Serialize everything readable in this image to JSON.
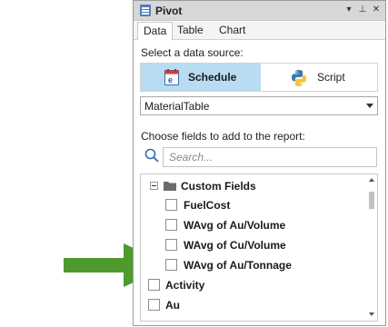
{
  "window": {
    "title": "Pivot",
    "dropdown_glyph": "▾",
    "pin_glyph": "⊥",
    "close_glyph": "✕"
  },
  "tabs": [
    {
      "label": "Data",
      "active": true
    },
    {
      "label": "Table",
      "active": false
    },
    {
      "label": "Chart",
      "active": false
    }
  ],
  "source": {
    "label": "Select a data source:",
    "options": [
      {
        "label": "Schedule",
        "icon": "schedule-icon",
        "selected": true
      },
      {
        "label": "Script",
        "icon": "python-icon",
        "selected": false
      }
    ],
    "selected_table": "MaterialTable"
  },
  "fields": {
    "label": "Choose fields to add to the report:",
    "search_placeholder": "Search...",
    "tree": [
      {
        "label": "Custom Fields",
        "type": "folder",
        "expanded": true
      },
      {
        "label": "FuelCost",
        "type": "field"
      },
      {
        "label": "WAvg of Au/Volume",
        "type": "field"
      },
      {
        "label": "WAvg of Cu/Volume",
        "type": "field"
      },
      {
        "label": "WAvg of Au/Tonnage",
        "type": "field"
      },
      {
        "label": "Activity",
        "type": "field"
      },
      {
        "label": "Au",
        "type": "field"
      }
    ]
  },
  "colors": {
    "selected_source": "#b9dcf3",
    "callout_arrow": "#4e9a2f",
    "titlebar": "#d7d7d7"
  }
}
